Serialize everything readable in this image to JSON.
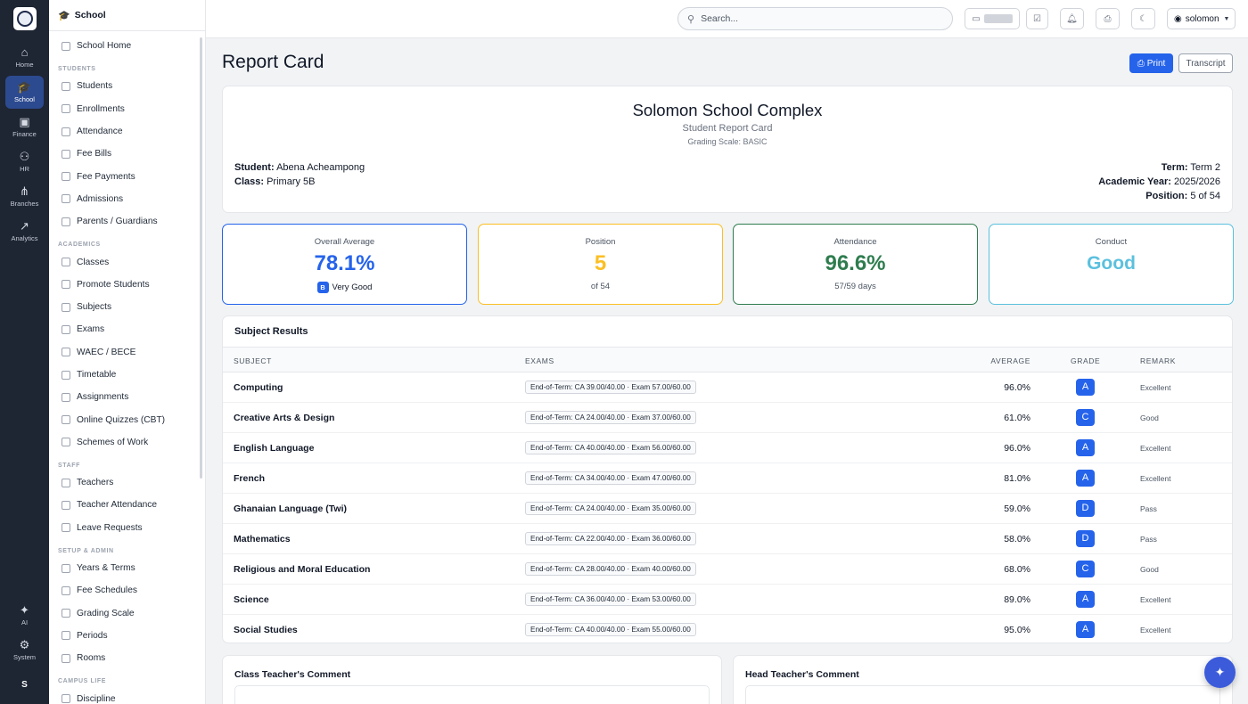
{
  "rail": {
    "items": [
      {
        "label": "Home",
        "icon": "home-icon",
        "glyph": "⌂"
      },
      {
        "label": "School",
        "icon": "graduation-cap-icon",
        "glyph": "🎓"
      },
      {
        "label": "Finance",
        "icon": "wallet-icon",
        "glyph": "▣"
      },
      {
        "label": "HR",
        "icon": "users-icon",
        "glyph": "⚇"
      },
      {
        "label": "Branches",
        "icon": "branches-icon",
        "glyph": "⋔"
      },
      {
        "label": "Analytics",
        "icon": "chart-icon",
        "glyph": "↗"
      }
    ],
    "bottom": [
      {
        "label": "AI",
        "icon": "sparkle-icon",
        "glyph": "✦"
      },
      {
        "label": "System",
        "icon": "gear-icon",
        "glyph": "⚙"
      }
    ],
    "avatar": "S"
  },
  "sidebar": {
    "title": "School",
    "home": "School Home",
    "sections": [
      {
        "heading": "STUDENTS",
        "items": [
          "Students",
          "Enrollments",
          "Attendance",
          "Fee Bills",
          "Fee Payments",
          "Admissions",
          "Parents / Guardians"
        ]
      },
      {
        "heading": "ACADEMICS",
        "items": [
          "Classes",
          "Promote Students",
          "Subjects",
          "Exams",
          "WAEC / BECE",
          "Timetable",
          "Assignments",
          "Online Quizzes (CBT)",
          "Schemes of Work"
        ]
      },
      {
        "heading": "STAFF",
        "items": [
          "Teachers",
          "Teacher Attendance",
          "Leave Requests"
        ]
      },
      {
        "heading": "SETUP & ADMIN",
        "items": [
          "Years & Terms",
          "Fee Schedules",
          "Grading Scale",
          "Periods",
          "Rooms"
        ]
      },
      {
        "heading": "CAMPUS LIFE",
        "items": [
          "Discipline"
        ]
      }
    ]
  },
  "topbar": {
    "search_placeholder": "Search...",
    "user": "solomon"
  },
  "page": {
    "title": "Report Card",
    "print_label": "Print",
    "transcript_label": "Transcript"
  },
  "header": {
    "school": "Solomon School Complex",
    "subtitle": "Student Report Card",
    "scale": "Grading Scale: BASIC",
    "student_label": "Student:",
    "student": "Abena Acheampong",
    "class_label": "Class:",
    "class": "Primary 5B",
    "term_label": "Term:",
    "term": "Term 2",
    "year_label": "Academic Year:",
    "year": "2025/2026",
    "position_label": "Position:",
    "position": "5 of 54"
  },
  "stats": {
    "average": {
      "title": "Overall Average",
      "value": "78.1%",
      "grade": "B",
      "sub": "Very Good",
      "color": "#2563eb"
    },
    "position": {
      "title": "Position",
      "value": "5",
      "sub": "of 54",
      "color": "#fbbf24"
    },
    "attendance": {
      "title": "Attendance",
      "value": "96.6%",
      "sub": "57/59 days",
      "color": "#2f7d4f"
    },
    "conduct": {
      "title": "Conduct",
      "value": "Good",
      "color": "#5bc0de"
    }
  },
  "results": {
    "title": "Subject Results",
    "columns": [
      "SUBJECT",
      "EXAMS",
      "AVERAGE",
      "GRADE",
      "REMARK"
    ],
    "rows": [
      {
        "subject": "Computing",
        "exams": "End-of-Term: CA 39.00/40.00 · Exam 57.00/60.00",
        "average": "96.0%",
        "grade": "A",
        "remark": "Excellent"
      },
      {
        "subject": "Creative Arts & Design",
        "exams": "End-of-Term: CA 24.00/40.00 · Exam 37.00/60.00",
        "average": "61.0%",
        "grade": "C",
        "remark": "Good"
      },
      {
        "subject": "English Language",
        "exams": "End-of-Term: CA 40.00/40.00 · Exam 56.00/60.00",
        "average": "96.0%",
        "grade": "A",
        "remark": "Excellent"
      },
      {
        "subject": "French",
        "exams": "End-of-Term: CA 34.00/40.00 · Exam 47.00/60.00",
        "average": "81.0%",
        "grade": "A",
        "remark": "Excellent"
      },
      {
        "subject": "Ghanaian Language (Twi)",
        "exams": "End-of-Term: CA 24.00/40.00 · Exam 35.00/60.00",
        "average": "59.0%",
        "grade": "D",
        "remark": "Pass"
      },
      {
        "subject": "Mathematics",
        "exams": "End-of-Term: CA 22.00/40.00 · Exam 36.00/60.00",
        "average": "58.0%",
        "grade": "D",
        "remark": "Pass"
      },
      {
        "subject": "Religious and Moral Education",
        "exams": "End-of-Term: CA 28.00/40.00 · Exam 40.00/60.00",
        "average": "68.0%",
        "grade": "C",
        "remark": "Good"
      },
      {
        "subject": "Science",
        "exams": "End-of-Term: CA 36.00/40.00 · Exam 53.00/60.00",
        "average": "89.0%",
        "grade": "A",
        "remark": "Excellent"
      },
      {
        "subject": "Social Studies",
        "exams": "End-of-Term: CA 40.00/40.00 · Exam 55.00/60.00",
        "average": "95.0%",
        "grade": "A",
        "remark": "Excellent"
      }
    ]
  },
  "comments": {
    "class_teacher": "Class Teacher's Comment",
    "head_teacher": "Head Teacher's Comment"
  }
}
